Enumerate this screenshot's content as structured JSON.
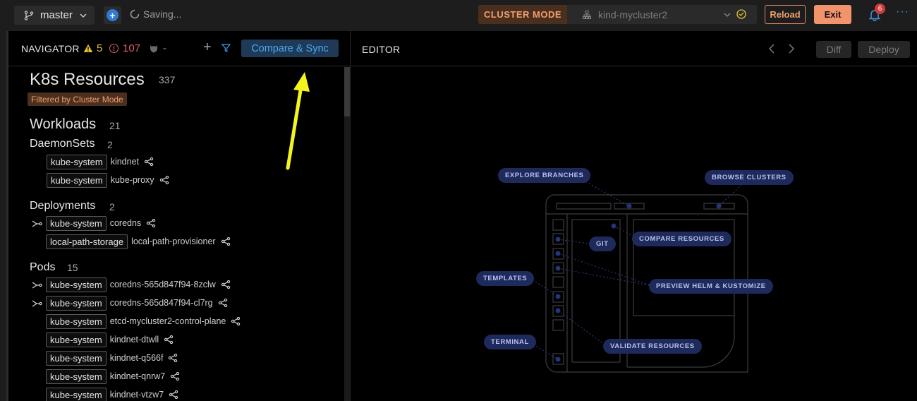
{
  "topbar": {
    "branch": "master",
    "status": "Saving...",
    "cluster_mode": "CLUSTER MODE",
    "cluster_name": "kind-mycluster2",
    "reload": "Reload",
    "exit": "Exit",
    "notifications": "6",
    "more": "···"
  },
  "navigator": {
    "title": "NAVIGATOR",
    "warnings": "5",
    "errors": "107",
    "policy": "-",
    "compare_sync": "Compare & Sync",
    "k8s_title": "K8s Resources",
    "k8s_count": "337",
    "filter_tag": "Filtered by Cluster Mode",
    "workloads": {
      "title": "Workloads",
      "count": "21"
    },
    "daemonsets": {
      "title": "DaemonSets",
      "count": "2",
      "rows": [
        {
          "ns": "kube-system",
          "name": "kindnet"
        },
        {
          "ns": "kube-system",
          "name": "kube-proxy"
        }
      ]
    },
    "deployments": {
      "title": "Deployments",
      "count": "2",
      "rows": [
        {
          "ns": "kube-system",
          "name": "coredns"
        },
        {
          "ns": "local-path-storage",
          "name": "local-path-provisioner"
        }
      ]
    },
    "pods": {
      "title": "Pods",
      "count": "15",
      "rows": [
        {
          "ns": "kube-system",
          "name": "coredns-565d847f94-8zclw"
        },
        {
          "ns": "kube-system",
          "name": "coredns-565d847f94-cl7rg"
        },
        {
          "ns": "kube-system",
          "name": "etcd-mycluster2-control-plane"
        },
        {
          "ns": "kube-system",
          "name": "kindnet-dtwll"
        },
        {
          "ns": "kube-system",
          "name": "kindnet-q566f"
        },
        {
          "ns": "kube-system",
          "name": "kindnet-qnrw7"
        },
        {
          "ns": "kube-system",
          "name": "kindnet-vtzw7"
        }
      ]
    }
  },
  "editor": {
    "title": "EDITOR",
    "diff": "Diff",
    "deploy": "Deploy",
    "labels": {
      "explore_branches": "EXPLORE BRANCHES",
      "browse_clusters": "BROWSE CLUSTERS",
      "compare_resources": "COMPARE RESOURCES",
      "git": "GIT",
      "templates": "TEMPLATES",
      "preview_helm": "PREVIEW HELM & KUSTOMIZE",
      "terminal": "TERMINAL",
      "validate_resources": "VALIDATE RESOURCES"
    }
  },
  "colors": {
    "accent_blue": "#4aa8f0",
    "cluster_orange": "#f0a070",
    "warning_yellow": "#e6c232",
    "error_red": "#e0606a",
    "annotation_arrow": "#f5f51e"
  }
}
